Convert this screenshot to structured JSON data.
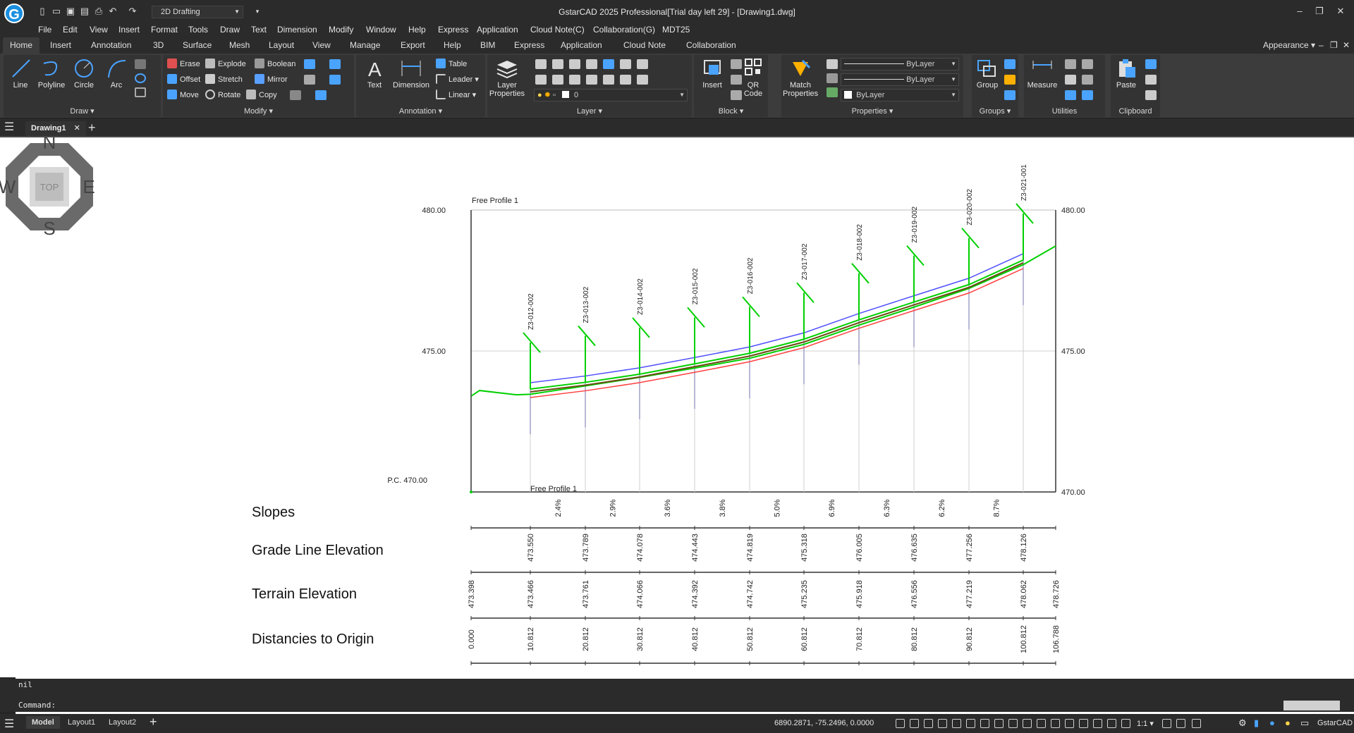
{
  "titlebar": {
    "window_title": "GstarCAD 2025 Professional[Trial day left 29] - [Drawing1.dwg]",
    "workspace": "2D Drafting",
    "app_logo_letter": "G"
  },
  "menu": [
    "File",
    "Edit",
    "View",
    "Insert",
    "Format",
    "Tools",
    "Draw",
    "Text",
    "Dimension",
    "Modify",
    "Window",
    "Help",
    "Express",
    "Application",
    "Cloud Note(C)",
    "Collaboration(G)",
    "MDT25"
  ],
  "ribbon_tabs": [
    "Home",
    "Insert",
    "Annotation",
    "3D",
    "Surface",
    "Mesh",
    "Layout",
    "View",
    "Manage",
    "Export",
    "Help",
    "BIM",
    "Express",
    "Application",
    "Cloud Note",
    "Collaboration"
  ],
  "appearance_label": "Appearance",
  "ribbon": {
    "draw": {
      "title": "Draw",
      "tools": [
        "Line",
        "Polyline",
        "Circle",
        "Arc"
      ]
    },
    "modify": {
      "title": "Modify",
      "tools": [
        "Erase",
        "Explode",
        "Boolean",
        "Offset",
        "Stretch",
        "Mirror",
        "Move",
        "Rotate",
        "Copy"
      ]
    },
    "annotation": {
      "title": "Annotation",
      "big": [
        "Text",
        "Dimension"
      ],
      "small": [
        "Table",
        "Leader",
        "Linear"
      ]
    },
    "layer": {
      "title": "Layer",
      "big": "Layer\nProperties",
      "current_layer": "0"
    },
    "block": {
      "title": "Block",
      "tools": [
        "Insert",
        "QR\nCode"
      ]
    },
    "properties": {
      "title": "Properties",
      "match": "Match\nProperties",
      "color": "ByLayer",
      "linetype": "ByLayer",
      "lineweight": "ByLayer"
    },
    "groups": {
      "title": "Groups",
      "big": "Group"
    },
    "utilities": {
      "title": "Utilities",
      "big": "Measure"
    },
    "clipboard": {
      "title": "Clipboard",
      "big": "Paste"
    }
  },
  "doc_tab": "Drawing1",
  "viewcube": {
    "N": "N",
    "S": "S",
    "E": "E",
    "W": "W",
    "top": "TOP"
  },
  "drawing": {
    "profile_label_top": "Free Profile 1",
    "profile_label_bottom": "Free Profile 1",
    "pc_label": "P.C. 470.00",
    "elev_labels_left": [
      "480.00",
      "475.00"
    ],
    "elev_labels_right": [
      "480.00",
      "475.00",
      "470.00"
    ],
    "row_titles": [
      "Slopes",
      "Grade Line Elevation",
      "Terrain Elevation",
      "Distancies to Origin"
    ],
    "stations": [
      "Z3-012-002",
      "Z3-013-002",
      "Z3-014-002",
      "Z3-015-002",
      "Z3-016-002",
      "Z3-017-002",
      "Z3-018-002",
      "Z3-019-002",
      "Z3-020-002",
      "Z3-021-001"
    ],
    "slopes": [
      "2.4%",
      "2.9%",
      "3.6%",
      "3.8%",
      "5.0%",
      "6.9%",
      "6.3%",
      "6.2%",
      "8.7%"
    ],
    "grade_elevations": [
      "473.550",
      "473.789",
      "474.078",
      "474.443",
      "474.819",
      "475.318",
      "476.005",
      "476.635",
      "477.256",
      "478.126"
    ],
    "terrain_elevations": [
      "473.398",
      "473.466",
      "473.761",
      "474.066",
      "474.392",
      "474.742",
      "475.235",
      "475.918",
      "476.556",
      "477.219",
      "478.062",
      "478.726"
    ],
    "distances": [
      "0.000",
      "10.812",
      "20.812",
      "30.812",
      "40.812",
      "50.812",
      "60.812",
      "70.812",
      "80.812",
      "90.812",
      "100.812",
      "106.788"
    ]
  },
  "command": {
    "history": "nil",
    "prompt": "Command:"
  },
  "status": {
    "layout_tabs": [
      "Model",
      "Layout1",
      "Layout2"
    ],
    "coordinates": "6890.2871, -75.2496, 0.0000",
    "scale": "1:1",
    "brand": "GstarCAD"
  },
  "colors": {
    "dark_bg": "#2b2b2b",
    "panel_bg": "#333333",
    "green_line": "#00d000",
    "blue_line": "#5050ff",
    "red_line": "#ff4040",
    "brown_line": "#6b4a12",
    "station_pole": "#a0a0c8"
  }
}
